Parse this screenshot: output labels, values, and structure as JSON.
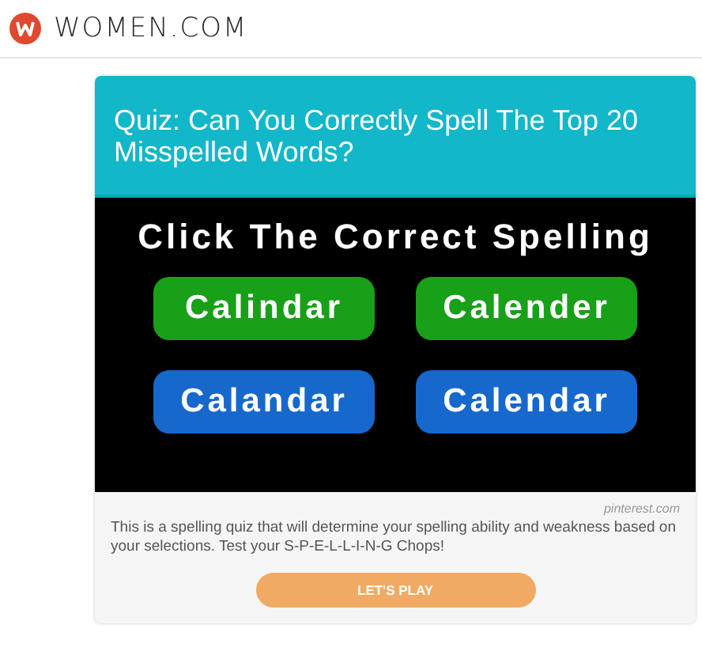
{
  "site": {
    "name": "WOMEN.COM"
  },
  "quiz": {
    "title": "Quiz: Can You Correctly Spell The Top 20 Misspelled Words?",
    "image": {
      "heading": "Click The Correct Spelling",
      "options": [
        {
          "label": "Calindar",
          "color": "#18a018"
        },
        {
          "label": "Calender",
          "color": "#18a018"
        },
        {
          "label": "Calandar",
          "color": "#1768cc"
        },
        {
          "label": "Calendar",
          "color": "#1768cc"
        }
      ]
    },
    "source": "pinterest.com",
    "description": "This is a spelling quiz that will determine your spelling ability and weakness based on your selections. Test your S-P-E-L-L-I-N-G Chops!",
    "button": "LET'S PLAY"
  }
}
